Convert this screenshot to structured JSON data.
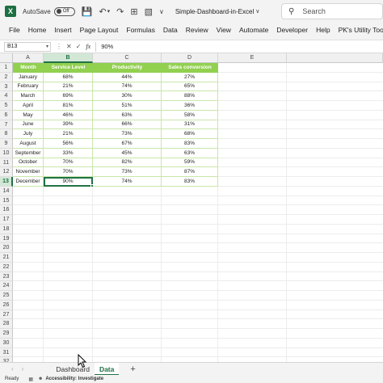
{
  "titlebar": {
    "autosave_label": "AutoSave",
    "autosave_state": "Off",
    "title": "Simple-Dashboard-in-Excel",
    "search_placeholder": "Search",
    "icons": [
      "excel-logo",
      "save-icon",
      "undo-icon",
      "redo-icon",
      "grid-icon",
      "format-icon",
      "more-icon"
    ]
  },
  "menu": [
    "File",
    "Home",
    "Insert",
    "Page Layout",
    "Formulas",
    "Data",
    "Review",
    "View",
    "Automate",
    "Developer",
    "Help",
    "PK's Utility Tool V"
  ],
  "formula_bar": {
    "name_box": "B13",
    "value": "90%"
  },
  "columns": [
    "A",
    "B",
    "C",
    "D",
    "E"
  ],
  "selected_column": "B",
  "selected_row": 13,
  "table": {
    "headers": [
      "Month",
      "Service Level",
      "Productivity",
      "Sales conversion"
    ],
    "rows": [
      [
        "January",
        "68%",
        "44%",
        "27%"
      ],
      [
        "February",
        "21%",
        "74%",
        "65%"
      ],
      [
        "March",
        "69%",
        "30%",
        "88%"
      ],
      [
        "April",
        "81%",
        "51%",
        "36%"
      ],
      [
        "May",
        "46%",
        "63%",
        "58%"
      ],
      [
        "June",
        "39%",
        "66%",
        "31%"
      ],
      [
        "July",
        "21%",
        "73%",
        "68%"
      ],
      [
        "August",
        "56%",
        "67%",
        "83%"
      ],
      [
        "September",
        "33%",
        "45%",
        "63%"
      ],
      [
        "October",
        "70%",
        "82%",
        "59%"
      ],
      [
        "November",
        "70%",
        "73%",
        "87%"
      ],
      [
        "December",
        "90%",
        "74%",
        "83%"
      ]
    ]
  },
  "row_count": 32,
  "sheets": [
    "Dashboard",
    "Data"
  ],
  "active_sheet": "Data",
  "status": {
    "ready": "Ready",
    "accessibility": "Accessibility: Investigate"
  },
  "colors": {
    "header_fill": "#92d050",
    "excel_green": "#217346",
    "table_border": "#c9e6a9"
  }
}
